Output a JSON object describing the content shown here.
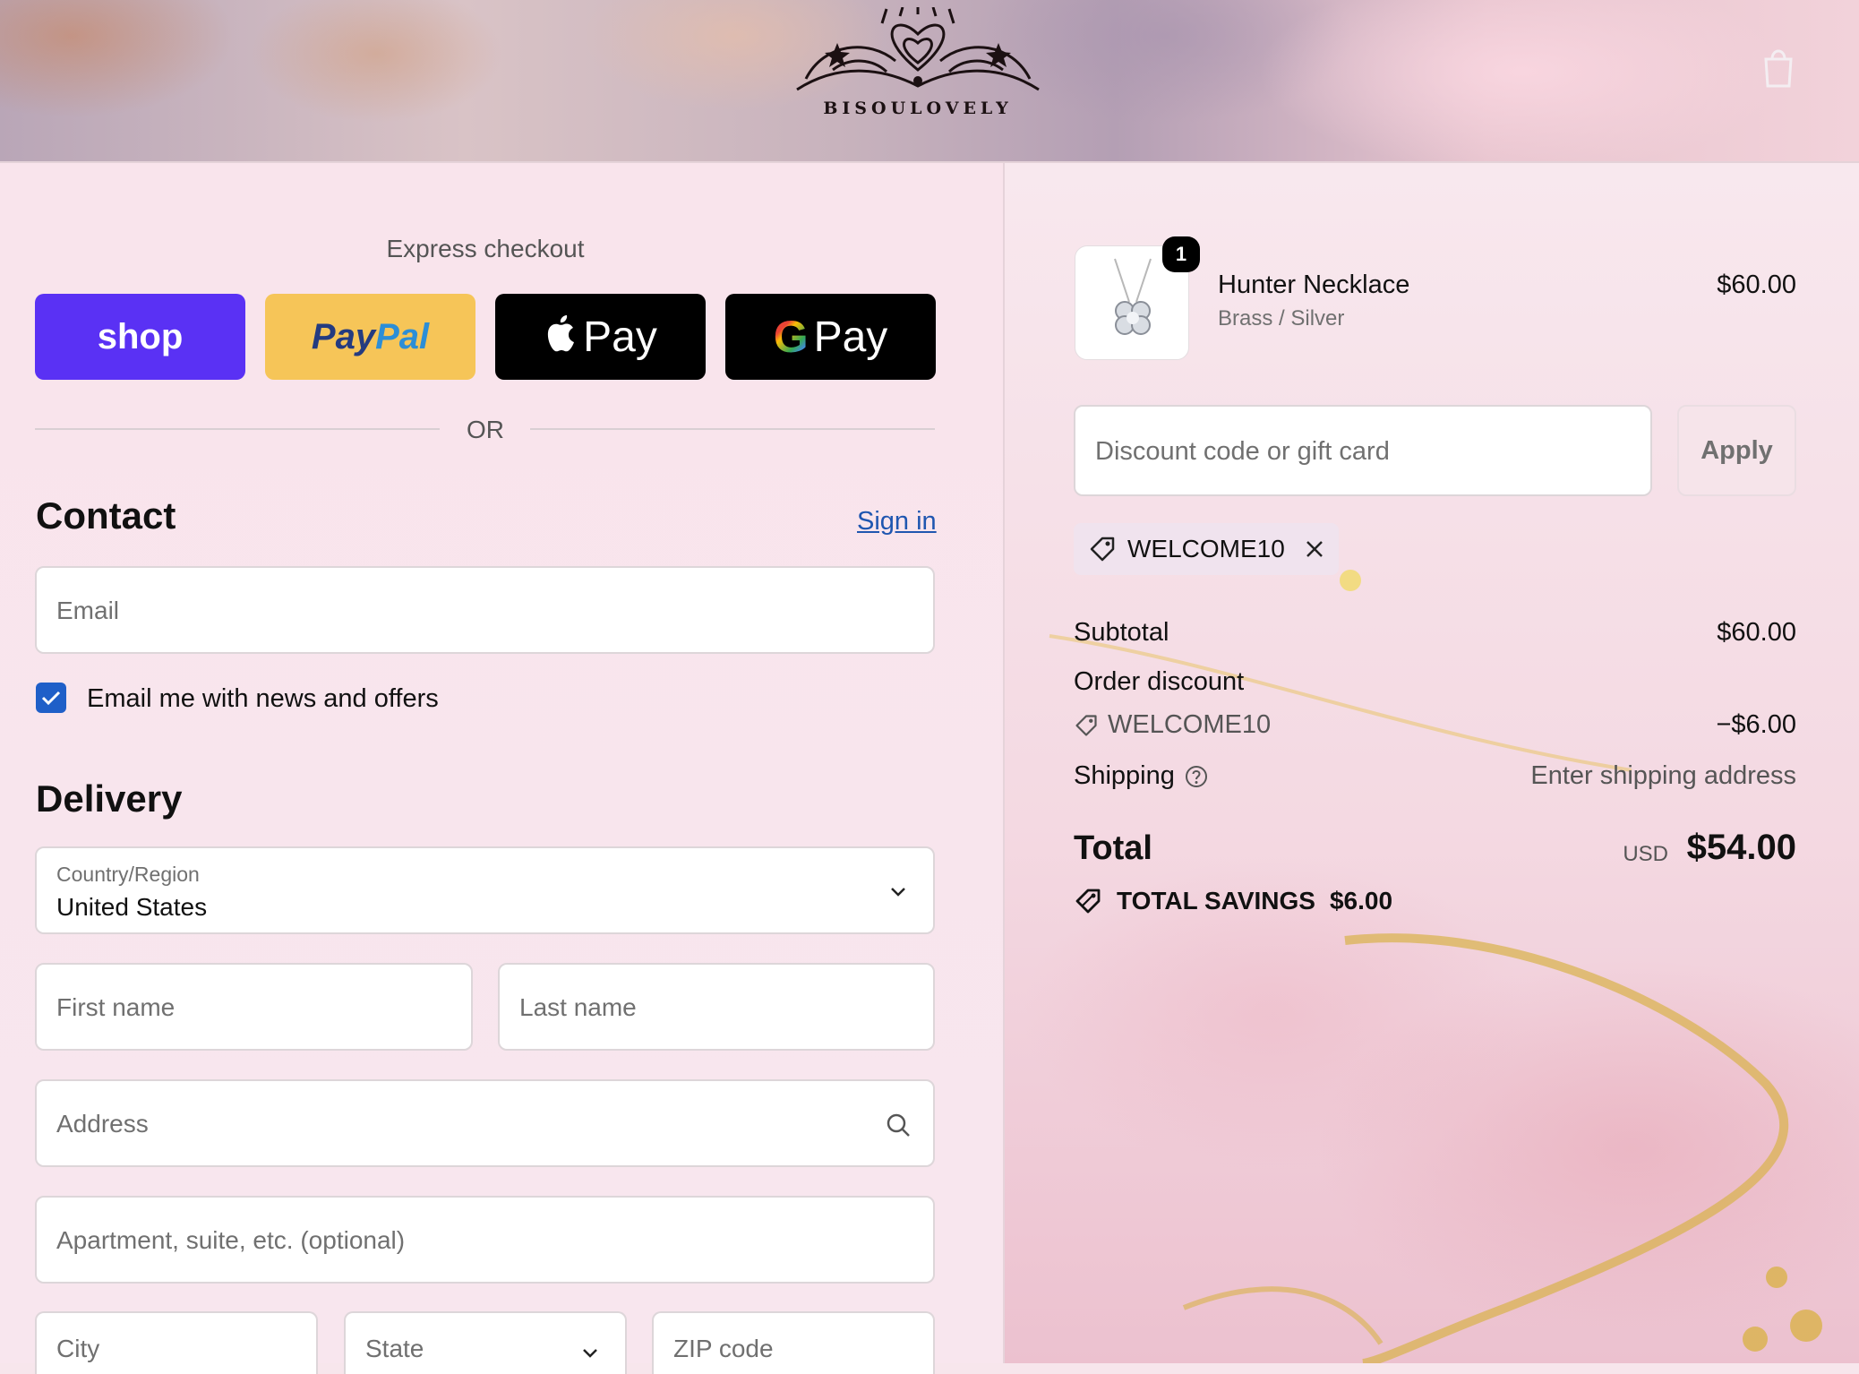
{
  "brand": {
    "name": "BISOULOVELY"
  },
  "header": {
    "cart_icon": "bag-icon"
  },
  "express": {
    "title": "Express checkout",
    "shop_label": "shop",
    "paypal_label_a": "Pay",
    "paypal_label_b": "Pal",
    "apple_label": "Pay",
    "google_g": "G",
    "google_label": "Pay",
    "or_label": "OR"
  },
  "contact": {
    "heading": "Contact",
    "sign_in": "Sign in",
    "email_placeholder": "Email",
    "newsletter_label": "Email me with news and offers",
    "newsletter_checked": true
  },
  "delivery": {
    "heading": "Delivery",
    "country_label": "Country/Region",
    "country_value": "United States",
    "first_name": "First name",
    "last_name": "Last name",
    "address": "Address",
    "apartment": "Apartment, suite, etc. (optional)",
    "city": "City",
    "state": "State",
    "zip": "ZIP code"
  },
  "summary": {
    "product": {
      "name": "Hunter Necklace",
      "variant": "Brass / Silver",
      "price": "$60.00",
      "quantity": "1"
    },
    "discount_placeholder": "Discount code or gift card",
    "apply_label": "Apply",
    "applied_code": "WELCOME10",
    "subtotal_label": "Subtotal",
    "subtotal_value": "$60.00",
    "order_discount_label": "Order discount",
    "discount_code": "WELCOME10",
    "discount_value": "−$6.00",
    "shipping_label": "Shipping",
    "shipping_value": "Enter shipping address",
    "total_label": "Total",
    "total_currency": "USD",
    "total_value": "$54.00",
    "savings_label": "TOTAL SAVINGS",
    "savings_value": "$6.00"
  },
  "colors": {
    "shop": "#5a31f4",
    "paypal": "#f6c558",
    "link": "#1f56b0",
    "checkbox": "#1f5fc8"
  }
}
